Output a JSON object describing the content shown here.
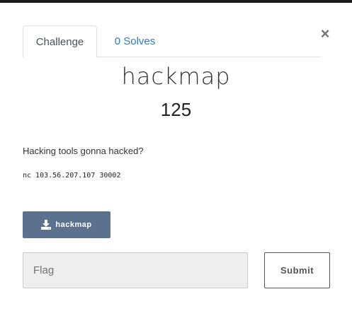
{
  "tabs": {
    "challenge_label": "Challenge",
    "solves_label": "0 Solves"
  },
  "close_label": "×",
  "challenge": {
    "name": "hackmap",
    "value": "125",
    "description": "Hacking tools gonna hacked?",
    "connection": "nc 103.56.207.107 30002"
  },
  "download": {
    "label": "hackmap",
    "icon": "download-icon"
  },
  "flag": {
    "placeholder": "Flag",
    "value": ""
  },
  "submit_label": "Submit",
  "colors": {
    "download_button_bg": "#5b718e",
    "tab_link": "#337ab7",
    "input_bg": "#eeeeee"
  }
}
